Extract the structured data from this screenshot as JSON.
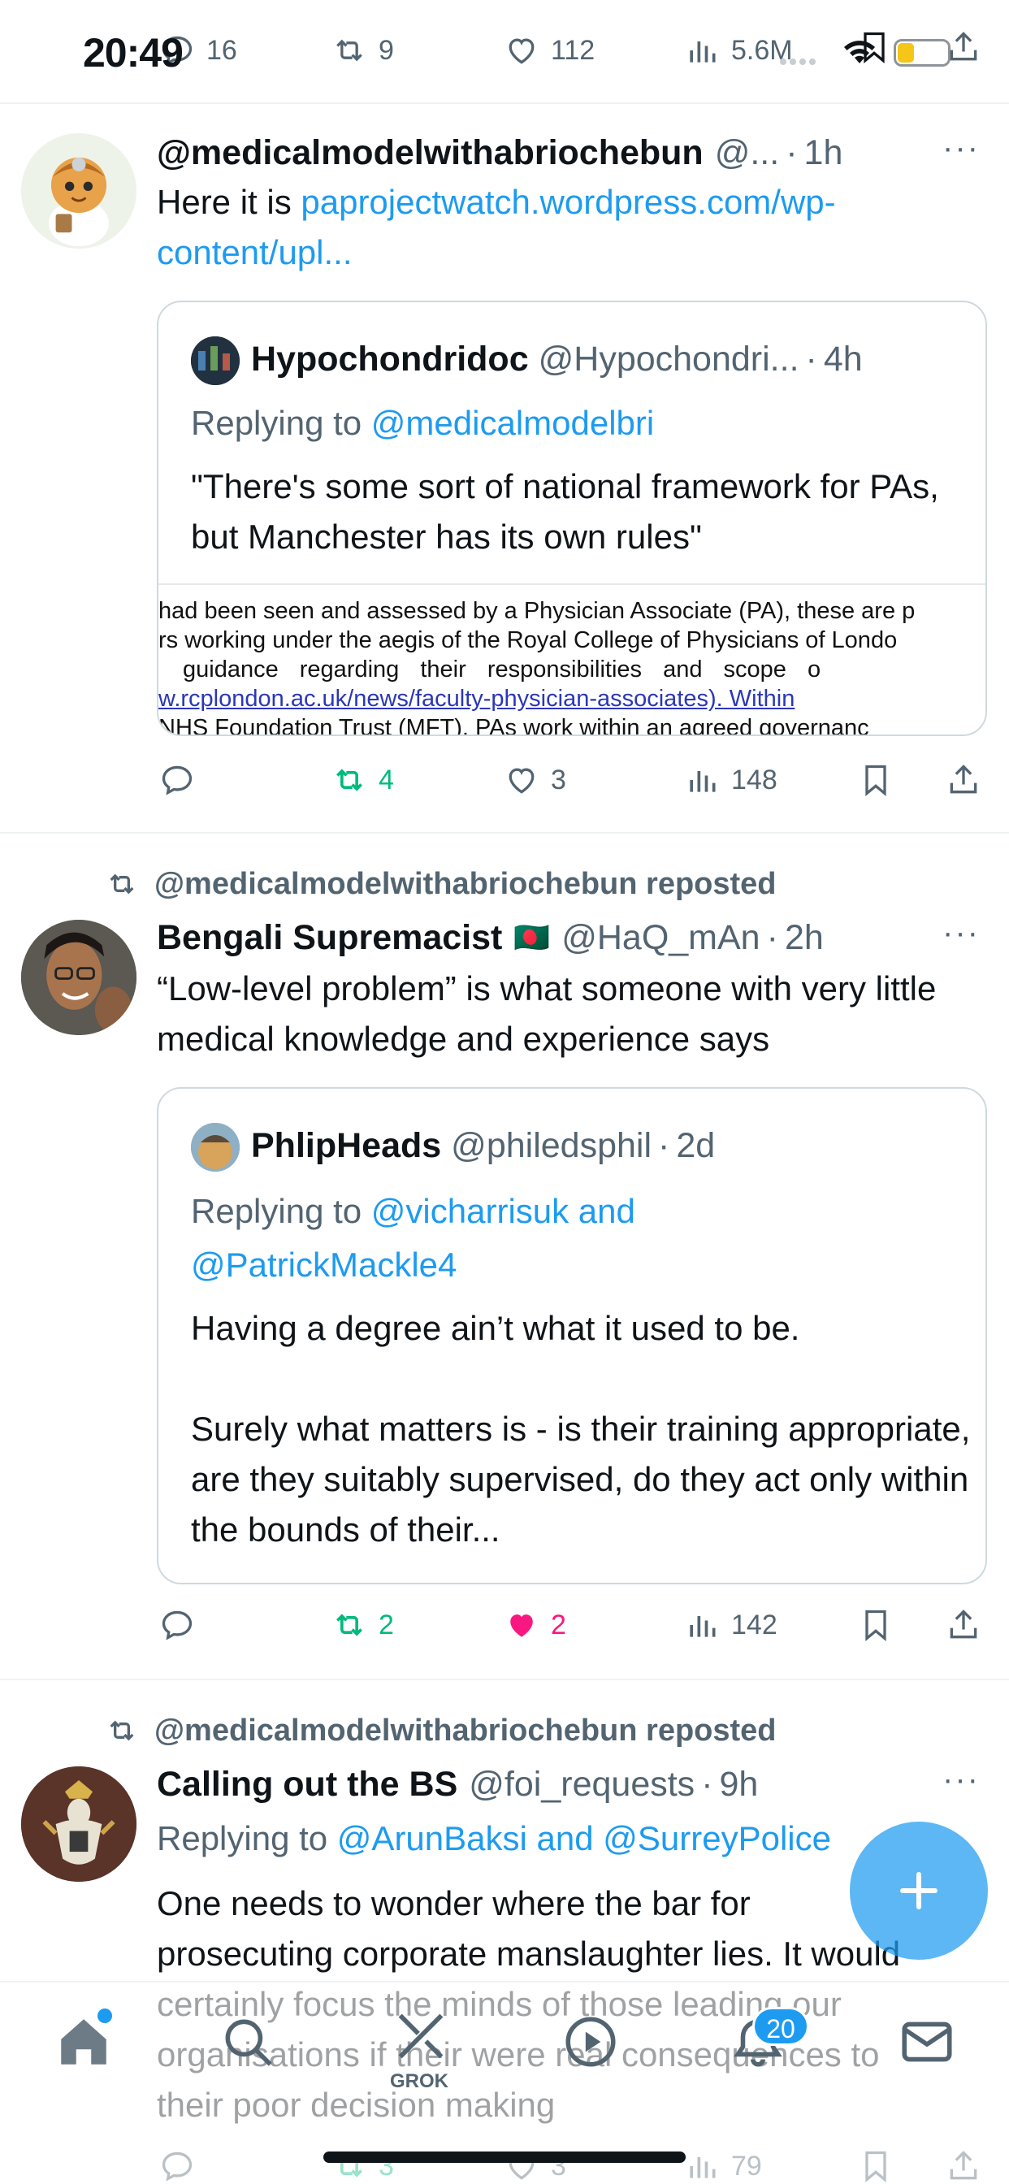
{
  "status_bar": {
    "time": "20:49"
  },
  "top_actions": {
    "replies": "16",
    "reposts": "9",
    "likes": "112",
    "views": "5.6M"
  },
  "post1": {
    "handle": "@medicalmodelwithabriochebun",
    "handle_trunc": "@...",
    "time": "1h",
    "text_prefix": "Here it is",
    "link": "paprojectwatch.wordpress.com/wp-content/upl...",
    "quote": {
      "name": "Hypochondridoc",
      "handle": "@Hypochondri...",
      "time": "4h",
      "replying_prefix": "Replying to",
      "replying_to": "@medicalmodelbri",
      "text": "\"There's some sort of national framework for PAs, but Manchester has its own rules\"",
      "doc_lines": [
        "had been seen and assessed by a Physician Associate (PA), these are p",
        "rs working under the aegis of the Royal College of Physicians of Londo",
        "guidance regarding their responsibilities and scope o",
        "w.rcplondon.ac.uk/news/faculty-physician-associates).        Within",
        "NHS Foundation Trust (MFT), PAs work within an agreed governanc"
      ]
    },
    "actions": {
      "reposts": "4",
      "likes": "3",
      "views": "148"
    }
  },
  "post2": {
    "reposted_by": "@medicalmodelwithabriochebun reposted",
    "name": "Bengali Supremacist",
    "flag": "🇧🇩",
    "handle": "@HaQ_mAn",
    "time": "2h",
    "text": "“Low-level problem” is what someone with very little medical knowledge and experience says",
    "quote": {
      "name": "PhlipHeads",
      "handle": "@philedsphil",
      "time": "2d",
      "replying_prefix": "Replying to",
      "replying_to_1": "@vicharrisuk and",
      "replying_to_2": "@PatrickMackle4",
      "text1": "Having a degree ain’t what it used to be.",
      "text2": "Surely what matters is - is their training appropriate, are they suitably supervised, do they act only within the bounds of their..."
    },
    "actions": {
      "reposts": "2",
      "likes": "2",
      "views": "142"
    }
  },
  "post3": {
    "reposted_by": "@medicalmodelwithabriochebun reposted",
    "name": "Calling out the BS",
    "handle": "@foi_requests",
    "time": "9h",
    "replying_prefix": "Replying to",
    "replying_to": "@ArunBaksi and @SurreyPolice",
    "text": "One needs to wonder where the bar for prosecuting corporate manslaughter lies. It would certainly focus the minds of those leading our organisations if their were real consequences to their poor decision making",
    "actions": {
      "reposts": "3",
      "likes": "3",
      "views": "79"
    }
  },
  "tabbar": {
    "grok_label": "GROK",
    "notifications_badge": "20"
  },
  "colors": {
    "accent": "#1d9bf0",
    "repost_green": "#00ba7c",
    "like_pink": "#f91880",
    "muted": "#536471"
  }
}
